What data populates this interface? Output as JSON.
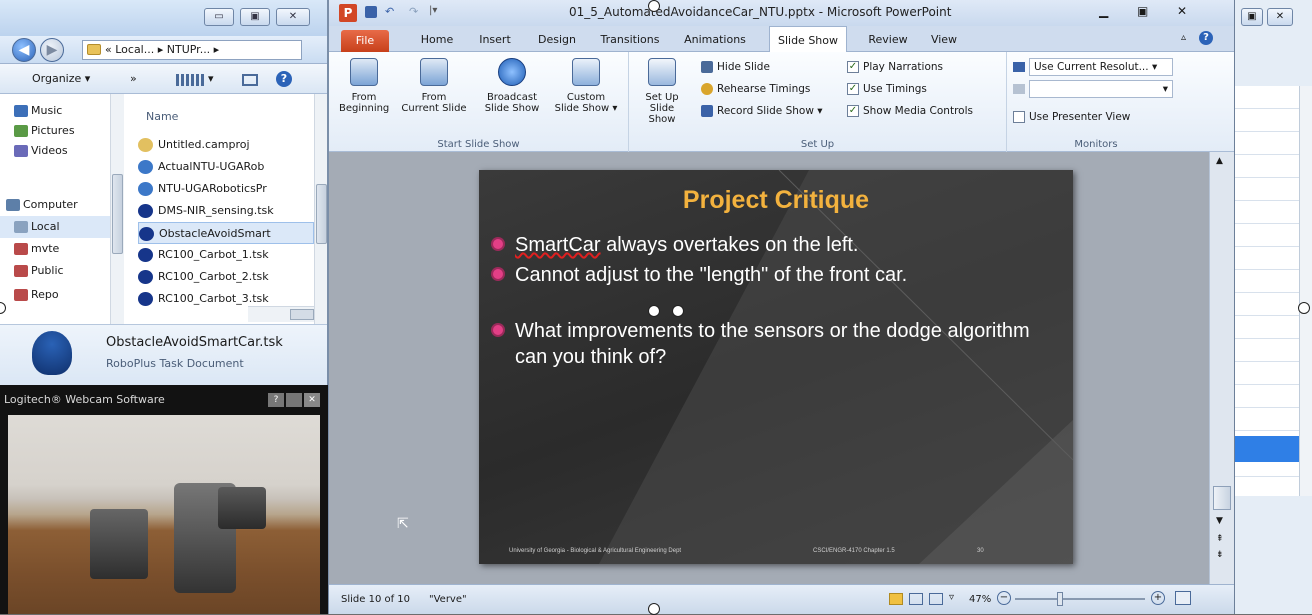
{
  "explorer": {
    "breadcrumb": "« Local... ▸ NTUPr... ▸",
    "toolbar": {
      "organize": "Organize ▾",
      "more": "»",
      "views": "▾"
    },
    "nav_items": [
      "Music",
      "Pictures",
      "Videos",
      "Computer",
      "Local",
      "mvte",
      "Public",
      "Repo"
    ],
    "column_header": "Name",
    "files": [
      {
        "name": "Untitled.camproj",
        "color": "#e2c060"
      },
      {
        "name": "ActualNTU-UGARob",
        "color": "#3c78c8"
      },
      {
        "name": "NTU-UGARoboticsPr",
        "color": "#3c78c8"
      },
      {
        "name": "DMS-NIR_sensing.tsk",
        "color": "#16358a"
      },
      {
        "name": "ObstacleAvoidSmart",
        "color": "#16358a"
      },
      {
        "name": "RC100_Carbot_1.tsk",
        "color": "#16358a"
      },
      {
        "name": "RC100_Carbot_2.tsk",
        "color": "#16358a"
      },
      {
        "name": "RC100_Carbot_3.tsk",
        "color": "#16358a"
      }
    ],
    "details": {
      "filename": "ObstacleAvoidSmartCar.tsk",
      "filetype": "RoboPlus Task Document"
    }
  },
  "webcam": {
    "title": "Logitech® Webcam Software"
  },
  "ppt": {
    "title": "01_5_AutomatedAvoidanceCar_NTU.pptx - Microsoft PowerPoint",
    "tabs": [
      "File",
      "Home",
      "Insert",
      "Design",
      "Transitions",
      "Animations",
      "Slide Show",
      "Review",
      "View"
    ],
    "active_tab": "Slide Show",
    "ribbon": {
      "start_group_label": "Start Slide Show",
      "from_beginning": "From\nBeginning",
      "from_current": "From\nCurrent Slide",
      "broadcast": "Broadcast\nSlide Show",
      "custom": "Custom\nSlide Show ▾",
      "setup_group_label": "Set Up",
      "setup_show": "Set Up\nSlide Show",
      "hide_slide": "Hide Slide",
      "rehearse": "Rehearse Timings",
      "record": "Record Slide Show ▾",
      "play_narrations": "Play Narrations",
      "use_timings": "Use Timings",
      "show_media_controls": "Show Media Controls",
      "monitors_group_label": "Monitors",
      "resolution": "Use Current Resolut... ▾",
      "show_on": "▾",
      "presenter_view": "Use Presenter View"
    },
    "slide": {
      "title": "Project Critique",
      "bullets": [
        {
          "lead": "SmartCar",
          "rest": " always overtakes on the left."
        },
        {
          "lead": "",
          "rest": "Cannot adjust to the \"length\" of the front car."
        },
        {
          "lead": "",
          "rest": "What improvements to the sensors or the dodge algorithm can you think of?"
        }
      ],
      "footer_left": "University of Georgia - Biological & Agricultural Engineering Dept",
      "footer_right": "CSCI/ENGR-4170 Chapter 1.5",
      "page_number": "30"
    },
    "status": {
      "slide_info": "Slide 10 of 10",
      "theme": "\"Verve\"",
      "zoom": "47%"
    }
  },
  "colors": {
    "ppt_accent": "#d24726",
    "slide_title": "#f3b23e",
    "bullet": "#e23f86"
  }
}
